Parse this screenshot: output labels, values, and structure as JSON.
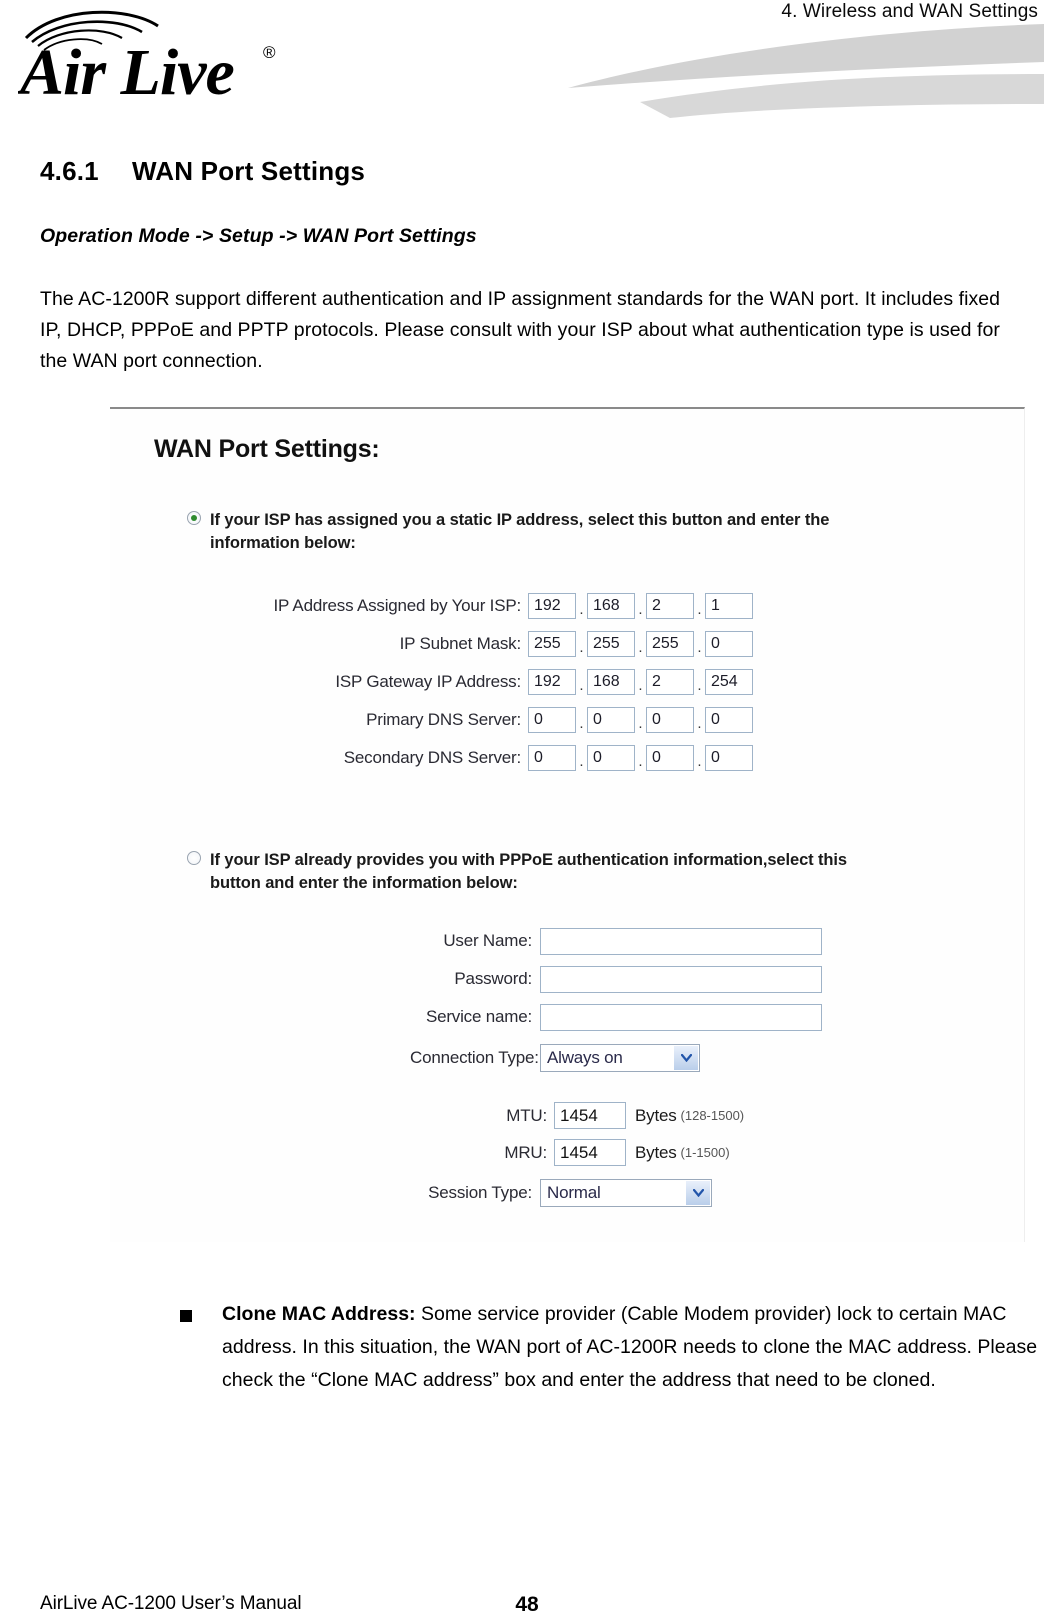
{
  "header": {
    "running_title": "4. Wireless and WAN Settings",
    "logo_text": "Air Live",
    "logo_registered": "®"
  },
  "document": {
    "section_number": "4.6.1",
    "section_title": "WAN Port Settings",
    "breadcrumb": "Operation Mode -> Setup -> WAN Port Settings",
    "intro_paragraph": "The AC-1200R support different authentication and IP assignment standards for the WAN port. It includes fixed IP, DHCP, PPPoE and PPTP protocols. Please consult with your ISP about what authentication type is used for the WAN port connection."
  },
  "panel": {
    "title": "WAN Port Settings:",
    "static_option": {
      "label": "If your ISP has assigned you a static IP address, select this button and enter the information below:",
      "selected": true
    },
    "pppoe_option": {
      "label": "If your ISP already provides you with PPPoE authentication information,select this button and enter the information below:",
      "selected": false
    },
    "ip_fields": [
      {
        "label": "IP Address Assigned by Your ISP:",
        "octets": [
          "192",
          "168",
          "2",
          "1"
        ]
      },
      {
        "label": "IP Subnet Mask:",
        "octets": [
          "255",
          "255",
          "255",
          "0"
        ]
      },
      {
        "label": "ISP Gateway IP Address:",
        "octets": [
          "192",
          "168",
          "2",
          "254"
        ]
      },
      {
        "label": "Primary DNS Server:",
        "octets": [
          "0",
          "0",
          "0",
          "0"
        ]
      },
      {
        "label": "Secondary DNS Server:",
        "octets": [
          "0",
          "0",
          "0",
          "0"
        ]
      }
    ],
    "octet_separator": ".",
    "pppoe_fields": [
      {
        "label": "User Name:",
        "value": ""
      },
      {
        "label": "Password:",
        "value": ""
      },
      {
        "label": "Service name:",
        "value": ""
      }
    ],
    "connection_type": {
      "label": "Connection Type:",
      "value": "Always on"
    },
    "mtu": {
      "label": "MTU:",
      "value": "1454",
      "unit": "Bytes",
      "range": "(128-1500)"
    },
    "mru": {
      "label": "MRU:",
      "value": "1454",
      "unit": "Bytes",
      "range": "(1-1500)"
    },
    "session_type": {
      "label": "Session Type:",
      "value": "Normal"
    }
  },
  "bullet": {
    "title": "Clone MAC Address:",
    "body": " Some service provider (Cable Modem provider) lock to certain MAC address. In this situation, the WAN port of AC-1200R needs to clone the MAC address. Please check the “Clone MAC address” box and enter the address that need to be cloned."
  },
  "footer": {
    "manual_name": "AirLive AC-1200 User’s Manual",
    "page_number": "48"
  },
  "colors": {
    "swoosh_gray": "#d2d2d2",
    "radio_green": "#2f8b2f",
    "field_border": "#9fb3c8",
    "panel_rule": "#8a8a8a"
  }
}
